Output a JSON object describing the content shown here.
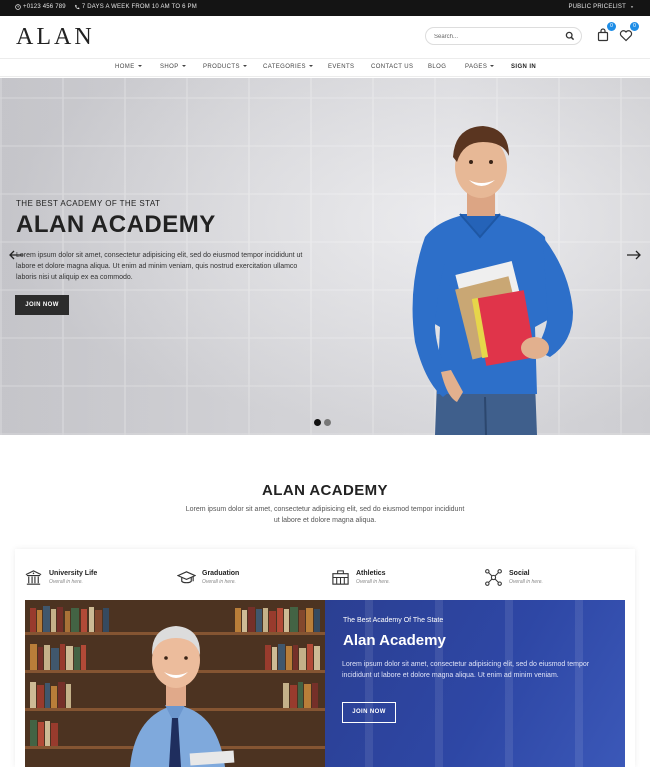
{
  "topbar": {
    "phone": "+0123 456 789",
    "hours": "7 DAYS A WEEK FROM 10 AM TO 6 PM",
    "pricelist": "PUBLIC PRICELIST",
    "phone_icon": "clock-icon",
    "hours_icon": "phone-icon"
  },
  "header": {
    "logo": "ALAN",
    "search_placeholder": "Search...",
    "cart_count": "0",
    "wishlist_count": "0"
  },
  "nav": {
    "items": [
      {
        "label": "HOME",
        "dropdown": true
      },
      {
        "label": "SHOP",
        "dropdown": true
      },
      {
        "label": "PRODUCTS",
        "dropdown": true
      },
      {
        "label": "CATEGORIES",
        "dropdown": true
      },
      {
        "label": "EVENTS",
        "dropdown": false
      },
      {
        "label": "CONTACT US",
        "dropdown": false
      },
      {
        "label": "BLOG",
        "dropdown": false
      },
      {
        "label": "PAGES",
        "dropdown": true
      },
      {
        "label": "SIGN IN",
        "dropdown": false
      }
    ]
  },
  "hero": {
    "subtitle": "THE BEST ACADEMY OF THE STAT",
    "title": "ALAN ACADEMY",
    "text": "Lorem ipsum dolor sit amet, consectetur adipisicing elit, sed do eiusmod tempor incididunt ut labore et dolore magna aliqua. Ut enim ad minim veniam, quis nostrud exercitation ullamco laboris nisi ut aliquip ex ea commodo.",
    "button": "JOIN NOW",
    "slides": 2,
    "active_slide": 1
  },
  "section": {
    "title": "ALAN ACADEMY",
    "text": "Lorem ipsum dolor sit amet, consectetur adipisicing elit, sed do eiusmod tempor incididunt ut labore et dolore magna aliqua."
  },
  "features": [
    {
      "title": "University Life",
      "subtitle": "Overall in here.",
      "icon": "university-building-icon"
    },
    {
      "title": "Graduation",
      "subtitle": "Overall in here.",
      "icon": "graduation-cap-icon"
    },
    {
      "title": "Athletics",
      "subtitle": "Overall in here.",
      "icon": "stadium-icon"
    },
    {
      "title": "Social",
      "subtitle": "Overall in here.",
      "icon": "network-icon"
    }
  ],
  "promo": {
    "subtitle": "The Best Academy Of The State",
    "title": "Alan Academy",
    "text": "Lorem ipsum dolor sit amet, consectetur adipisicing elit, sed do eiusmod tempor incididunt ut labore et dolore magna aliqua. Ut enim ad minim veniam.",
    "button": "JOIN NOW"
  },
  "colors": {
    "topbar": "#141414",
    "accent_badge": "#1e8de6",
    "promo_blue": "#2e47a5",
    "button_dark": "#2c2c2c"
  }
}
